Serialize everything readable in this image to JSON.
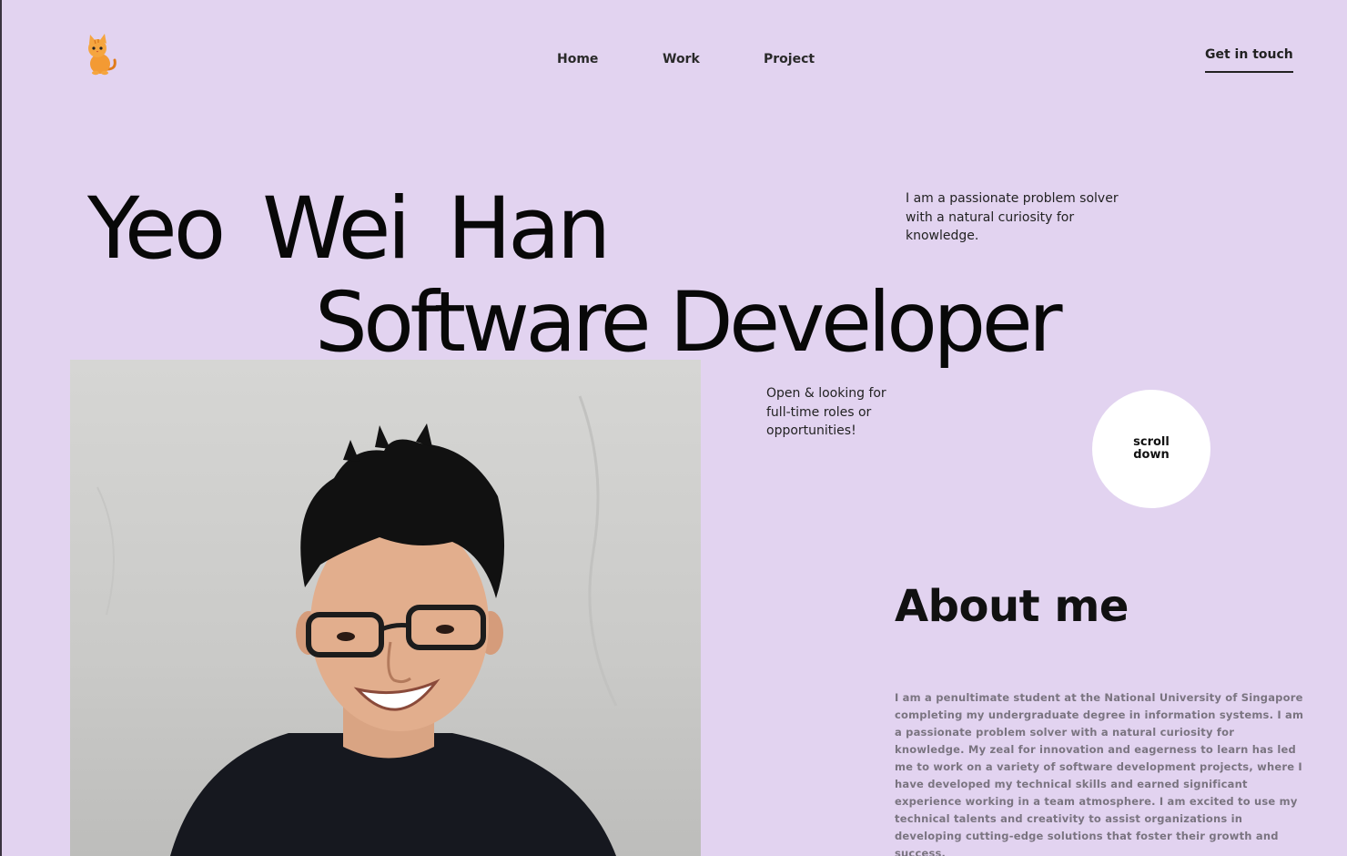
{
  "header": {
    "logo_icon": "cat-icon",
    "nav": [
      "Home",
      "Work",
      "Project"
    ],
    "cta_label": "Get in touch"
  },
  "hero": {
    "name": "Yeo Wei Han",
    "role": "Software Developer",
    "intro": "I am a passionate problem solver with a natural curiosity for knowledge.",
    "availability": "Open & looking for full-time roles or opportunities!",
    "scroll_label": "scroll down"
  },
  "about": {
    "title": "About me",
    "body": "I am a penultimate student at the National University of Singapore completing my undergraduate degree in information systems. I am a passionate problem solver with a natural curiosity for knowledge. My zeal for innovation and eagerness to learn has led me to work on a variety of software development projects, where I have developed my technical skills and earned significant experience working in a team atmosphere. I am excited to use my technical talents and creativity to assist organizations in developing cutting-edge solutions that foster their growth and success."
  },
  "colors": {
    "background": "#e2d3f0",
    "text": "#111111",
    "muted": "#7a7480",
    "accent_logo": "#f08a24"
  }
}
